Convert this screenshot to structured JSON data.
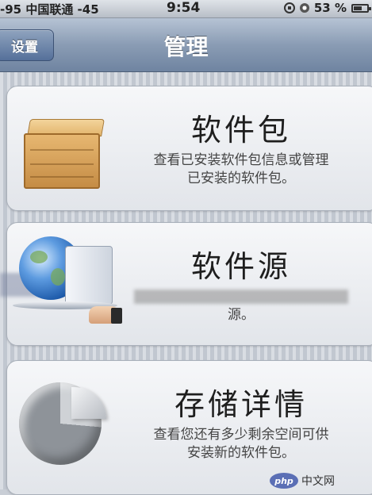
{
  "status_bar": {
    "carrier": "-95 中国联通 -45",
    "time": "9:54",
    "battery": "53 %",
    "battery_level_percent": 53,
    "icons": [
      "rotation-lock-icon",
      "alarm-icon",
      "battery-icon"
    ]
  },
  "nav": {
    "back_label": "设置",
    "title": "管理"
  },
  "cells": [
    {
      "title": "软件包",
      "desc_line1": "查看已安装软件包信息或管理",
      "desc_line2": "已安装的软件包。",
      "icon": "package-crate-icon"
    },
    {
      "title": "软件源",
      "desc_line1": "",
      "desc_line2": "源。",
      "icon": "globe-server-icon"
    },
    {
      "title": "存储详情",
      "desc_line1": "查看您还有多少剩余空间可供",
      "desc_line2": "安装新的软件包。",
      "icon": "storage-pie-icon"
    }
  ],
  "watermark": {
    "logo": "php",
    "text": "中文网"
  }
}
